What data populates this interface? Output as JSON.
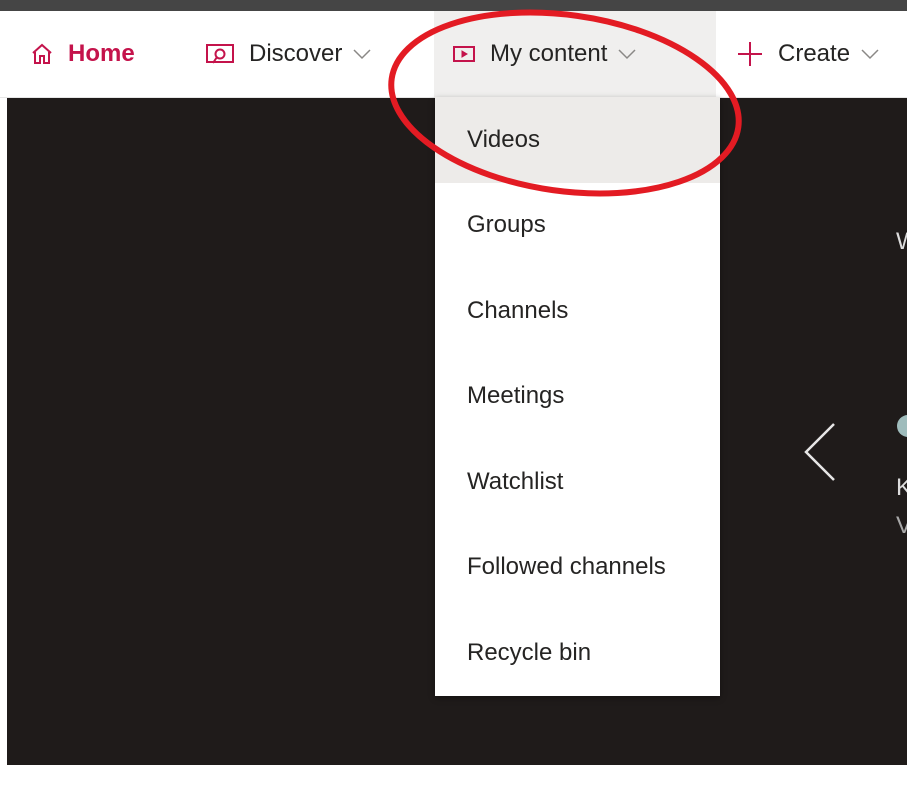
{
  "nav": {
    "home": {
      "label": "Home",
      "icon": "home-icon"
    },
    "discover": {
      "label": "Discover",
      "icon": "discover-icon"
    },
    "my_content": {
      "label": "My content",
      "icon": "video-frame-icon"
    },
    "create": {
      "label": "Create",
      "icon": "plus-icon"
    }
  },
  "dropdown": {
    "items": [
      {
        "label": "Videos",
        "active": true
      },
      {
        "label": "Groups"
      },
      {
        "label": "Channels"
      },
      {
        "label": "Meetings"
      },
      {
        "label": "Watchlist"
      },
      {
        "label": "Followed channels"
      },
      {
        "label": "Recycle bin"
      }
    ]
  },
  "hero": {
    "partial_text_1": "W",
    "partial_text_2": "K",
    "partial_text_3": "V"
  },
  "colors": {
    "brand": "#c4134b",
    "annotation": "#e31b23",
    "hero_bg": "#1f1b1a"
  }
}
